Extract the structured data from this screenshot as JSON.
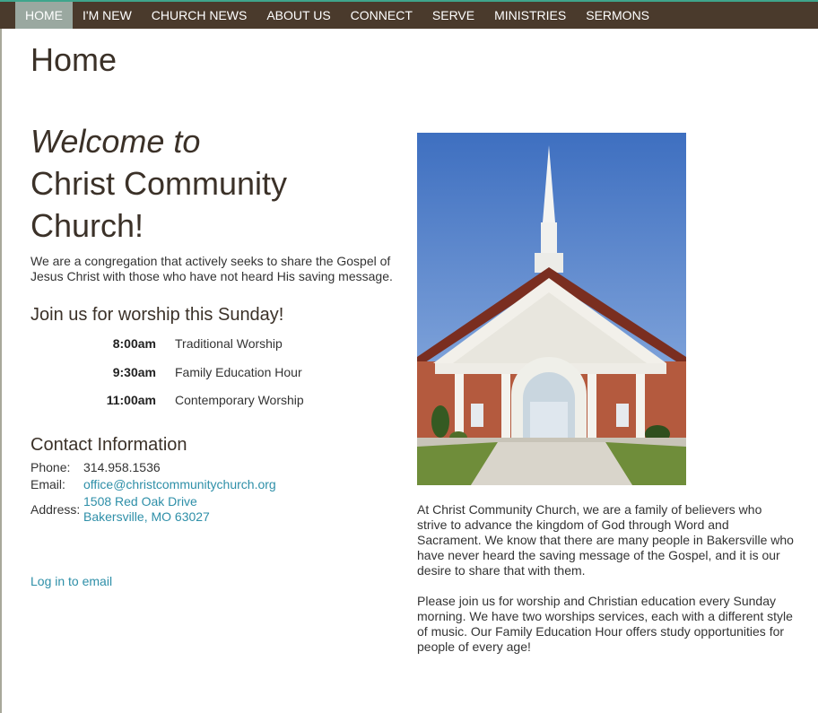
{
  "nav": {
    "items": [
      {
        "label": "HOME"
      },
      {
        "label": "I'M NEW"
      },
      {
        "label": "CHURCH NEWS"
      },
      {
        "label": "ABOUT US"
      },
      {
        "label": "CONNECT"
      },
      {
        "label": "SERVE"
      },
      {
        "label": "MINISTRIES"
      },
      {
        "label": "SERMONS"
      }
    ],
    "active": "HOME"
  },
  "page_title": "Home",
  "welcome": {
    "line1": "Welcome to",
    "line2": "Christ Community",
    "line3": "Church!"
  },
  "intro": "We are a congregation that actively seeks to share the Gospel of Jesus Christ with those who have not heard His saving message.",
  "worship": {
    "heading": "Join us for worship this Sunday!",
    "services": [
      {
        "time": "8:00am",
        "name": "Traditional Worship"
      },
      {
        "time": "9:30am",
        "name": "Family Education Hour"
      },
      {
        "time": "11:00am",
        "name": "Contemporary Worship"
      }
    ]
  },
  "contact": {
    "heading": "Contact Information",
    "phone_label": "Phone:",
    "phone": "314.958.1536",
    "email_label": "Email:",
    "email": "office@christcommunitychurch.org",
    "address_label": "Address:",
    "address_line1": "1508 Red Oak Drive",
    "address_line2": "Bakersville, MO 63027"
  },
  "login_link": "Log in to email",
  "about": {
    "para1": "At Christ Community Church, we are a family of believers who strive to advance the kingdom of God through Word and Sacrament. We know that there are many people in Bakersville who have never heard the saving message of the Gospel, and it is our desire to share that with them.",
    "para2": "Please join us for worship and Christian education every Sunday morning. We have two worships services, each with a different style of music. Our Family Education Hour offers study opportunities for people of every age!"
  },
  "colors": {
    "nav_bg": "#4a3a2c",
    "nav_active_bg": "#9aa8a0",
    "heading": "#3b3128",
    "link": "#2e8fa8"
  }
}
